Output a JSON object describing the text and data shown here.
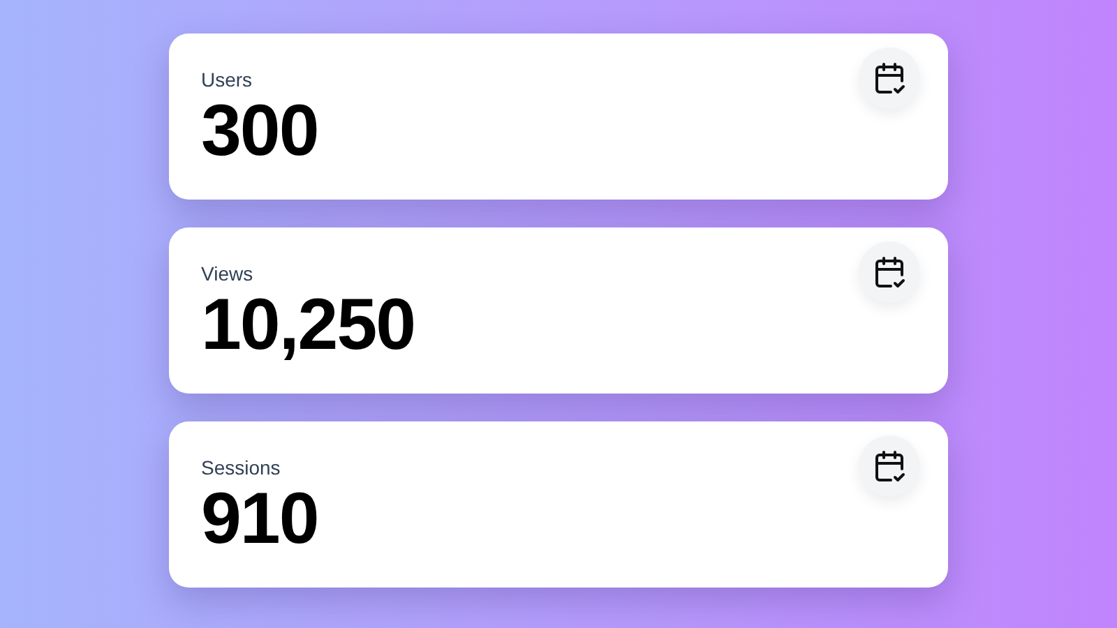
{
  "cards": [
    {
      "label": "Users",
      "value": "300"
    },
    {
      "label": "Views",
      "value": "10,250"
    },
    {
      "label": "Sessions",
      "value": "910"
    }
  ]
}
